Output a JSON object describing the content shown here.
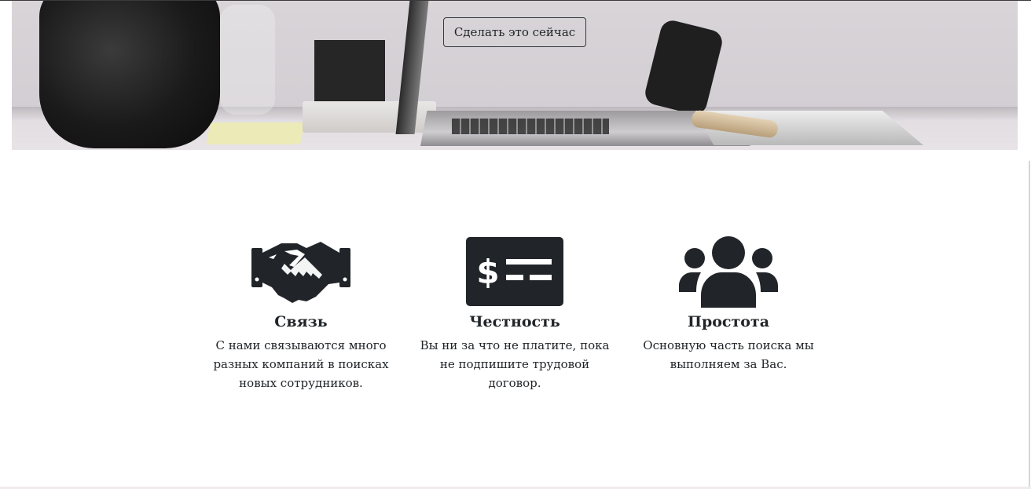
{
  "hero": {
    "cta_label": "Сделать это сейчас"
  },
  "features": [
    {
      "icon": "handshake-icon",
      "title": "Связь",
      "text": "С нами связываются много разных компаний в поисках новых сотрудников."
    },
    {
      "icon": "money-check-icon",
      "title": "Честность",
      "text": "Вы ни за что не платите, пока не подпишите трудовой договор."
    },
    {
      "icon": "users-icon",
      "title": "Простота",
      "text": "Основную часть поиска мы выполняем за Вас."
    }
  ],
  "colors": {
    "text": "#212529",
    "icon": "#212529",
    "button_border": "#343a40"
  }
}
